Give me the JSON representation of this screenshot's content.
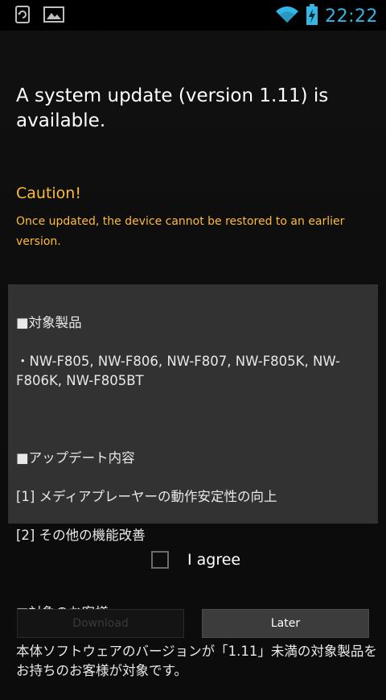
{
  "status_bar": {
    "time": "22:22",
    "icons": [
      "sync-icon",
      "image-icon",
      "wifi-icon",
      "battery-charging-icon"
    ],
    "accent_color": "#33b5e5"
  },
  "title": "A system update (version 1.11) is available.",
  "caution": {
    "title": "Caution!",
    "text": "Once updated, the device cannot be restored to an earlier version.",
    "color": "#ffbb33"
  },
  "info": {
    "products_header": "■対象製品",
    "products_list": "・NW-F805, NW-F806, NW-F807, NW-F805K, NW-F806K, NW-F805BT",
    "changes_header": "■アップデート内容",
    "change_1": "[1] メディアプレーヤーの動作安定性の向上",
    "change_2": "[2] その他の機能改善",
    "customers_header": "■対象のお客様",
    "customers_text": "本体ソフトウェアのバージョンが「1.11」未満の対象製品をお持ちのお客様が対象です。"
  },
  "agree": {
    "label": "I agree",
    "checked": false
  },
  "buttons": {
    "download": "Download",
    "later": "Later"
  }
}
